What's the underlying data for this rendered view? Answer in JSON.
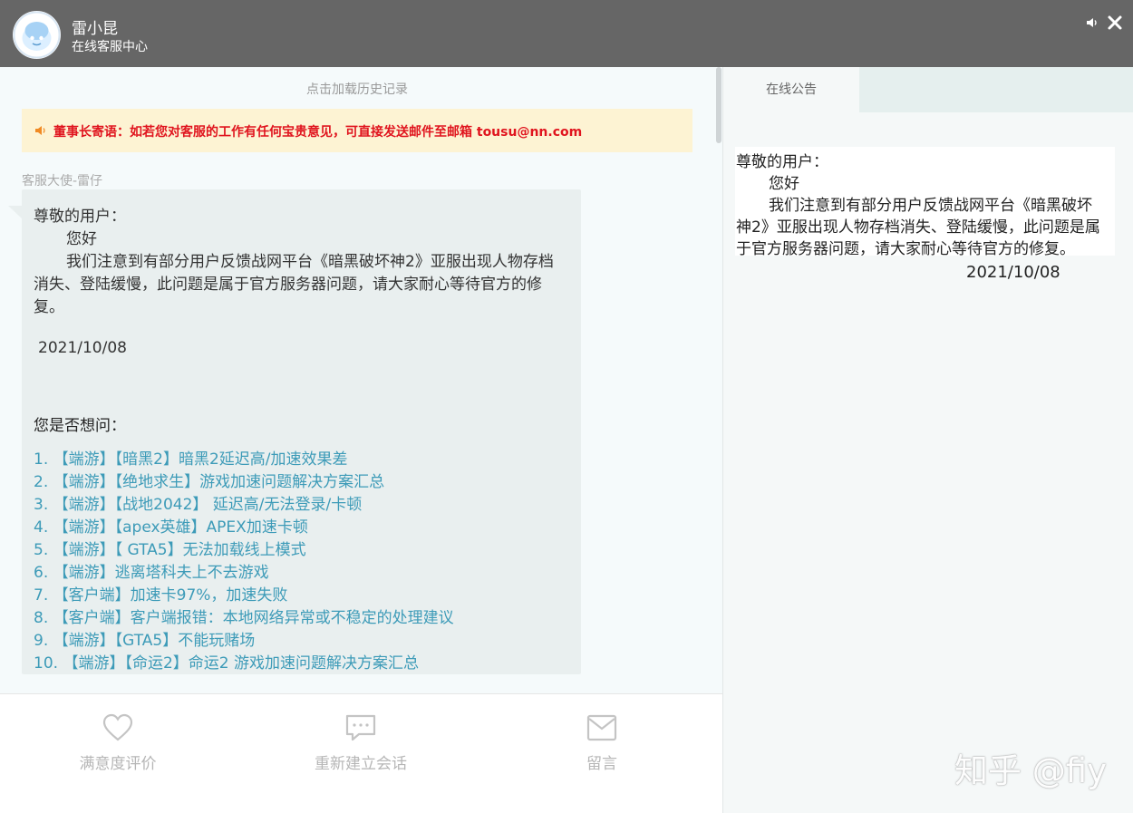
{
  "header": {
    "name": "雷小昆",
    "subtitle": "在线客服中心"
  },
  "chat": {
    "history_link": "点击加载历史记录",
    "notice": "董事长寄语：如若您对客服的工作有任何宝贵意见，可直接发送邮件至邮箱 tousu@nn.com",
    "agent_name": "客服大使-雷仔",
    "message": {
      "greeting": "尊敬的用户：",
      "hello": "您好",
      "body_line1": "我们注意到有部分用户反馈战网平台《暗黑破坏神2》亚服出现人物存档",
      "body_line2": "消失、登陆缓慢，此问题是属于官方服务器问题，请大家耐心等待官方的修",
      "body_line3": "复。",
      "date": "2021/10/08"
    },
    "faq_heading": "您是否想问：",
    "faq": [
      "1. 【端游】【暗黑2】暗黑2延迟高/加速效果差",
      "2. 【端游】【绝地求生】游戏加速问题解决方案汇总",
      "3. 【端游】【战地2042】 延迟高/无法登录/卡顿",
      "4. 【端游】【apex英雄】APEX加速卡顿",
      "5. 【端游】【 GTA5】无法加载线上模式",
      "6. 【端游】逃离塔科夫上不去游戏",
      "7. 【客户端】加速卡97%，加速失败",
      "8. 【客户端】客户端报错：本地网络异常或不稳定的处理建议",
      "9. 【端游】【GTA5】不能玩赌场",
      "10. 【端游】【命运2】命运2 游戏加速问题解决方案汇总"
    ]
  },
  "actions": {
    "rate_label": "满意度评价",
    "new_session_label": "重新建立会话",
    "leave_message_label": "留言"
  },
  "sidebar": {
    "tab_label": "在线公告",
    "announcement": {
      "greeting": "尊敬的用户：",
      "hello": "您好",
      "line1": "我们注意到有部分用户反馈战网平台《暗黑破坏",
      "line2": "神2》亚服出现人物存档消失、登陆缓慢，此问题是属",
      "line3": "于官方服务器问题，请大家耐心等待官方的修复。",
      "date": "2021/10/08"
    }
  },
  "watermark": "知乎 @fiy",
  "colors": {
    "titlebar": "#666666",
    "notice_text": "#e0141e",
    "notice_bg": "#fdf3d3",
    "link": "#3d9bb8",
    "bubble": "#e9efef"
  },
  "icons": {
    "sound": "speaker-icon",
    "close": "close-icon",
    "rate": "heart-icon",
    "new_session": "chat-bubble-icon",
    "leave_message": "envelope-icon"
  }
}
